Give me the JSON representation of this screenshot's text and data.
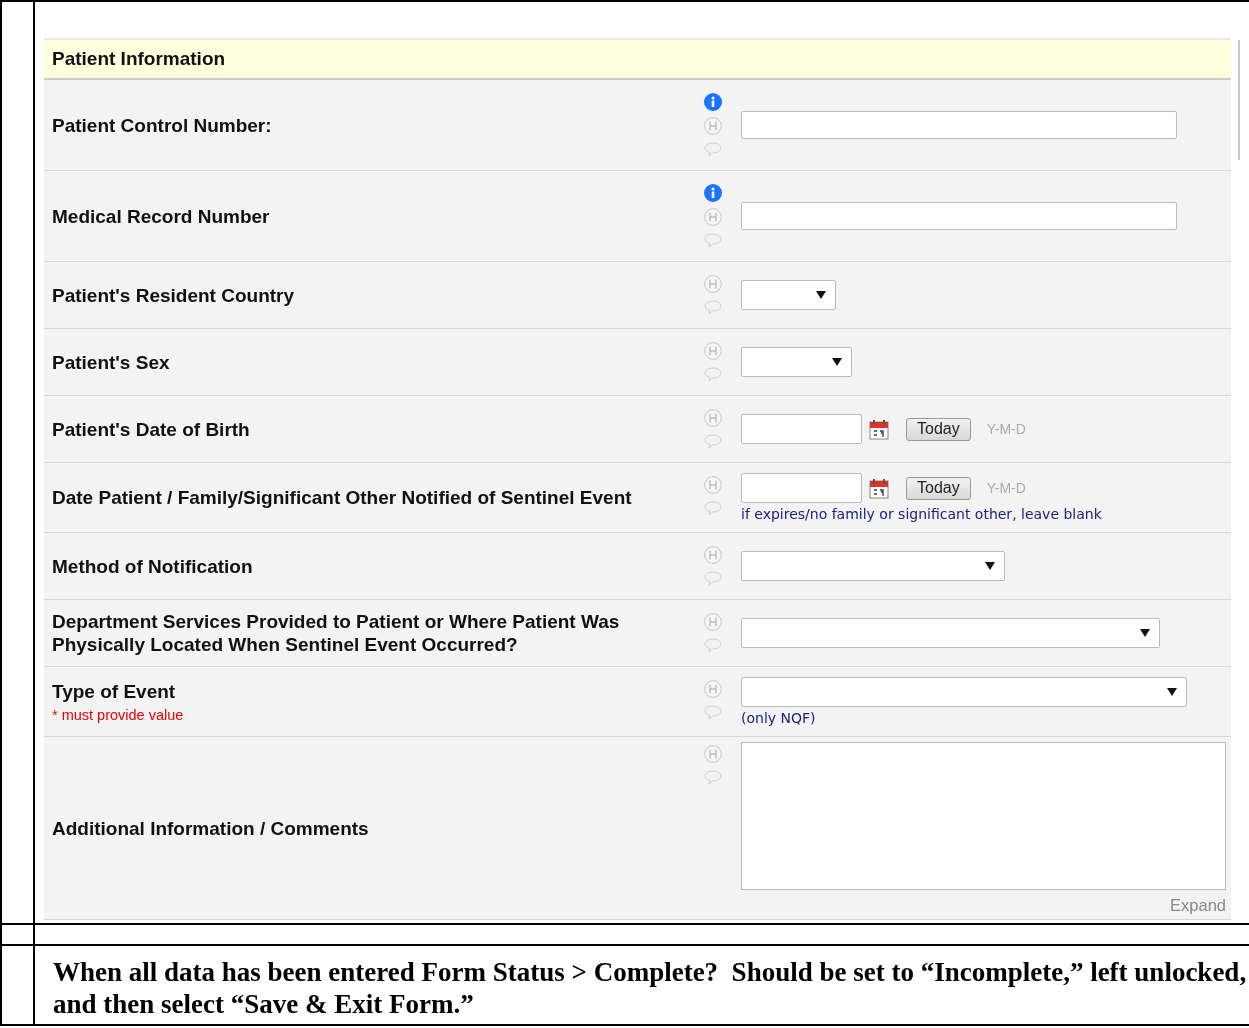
{
  "form": {
    "section_header": "Patient Information",
    "fields": [
      {
        "label": "Patient Control Number:",
        "kind": "text",
        "info": true
      },
      {
        "label": "Medical Record Number",
        "kind": "text",
        "info": true
      },
      {
        "label": "Patient's Resident Country",
        "kind": "select",
        "info": false
      },
      {
        "label": "Patient's Sex",
        "kind": "select",
        "info": false
      },
      {
        "label": "Patient's Date of Birth",
        "kind": "date",
        "info": false,
        "today_button": "Today",
        "format": "Y-M-D"
      },
      {
        "label": "Date Patient / Family/Significant Other Notified of Sentinel Event",
        "kind": "date",
        "info": false,
        "today_button": "Today",
        "format": "Y-M-D",
        "note": "if expires/no family or significant other, leave blank"
      },
      {
        "label": "Method of Notification",
        "kind": "select",
        "info": false
      },
      {
        "label": "Department Services Provided to Patient or Where Patient Was Physically Located When Sentinel Event Occurred?",
        "kind": "select",
        "info": false
      },
      {
        "label": "Type of Event",
        "kind": "select",
        "info": false,
        "required_note": "* must provide value",
        "note": "(only NQF)"
      },
      {
        "label": "Additional Information / Comments",
        "kind": "textarea",
        "info": false,
        "expand_link": "Expand"
      }
    ]
  },
  "instructions": "When all data has been entered Form Status > Complete?  Should be set to “Incomplete,” left unlocked, and then select “Save & Exit Form.”"
}
